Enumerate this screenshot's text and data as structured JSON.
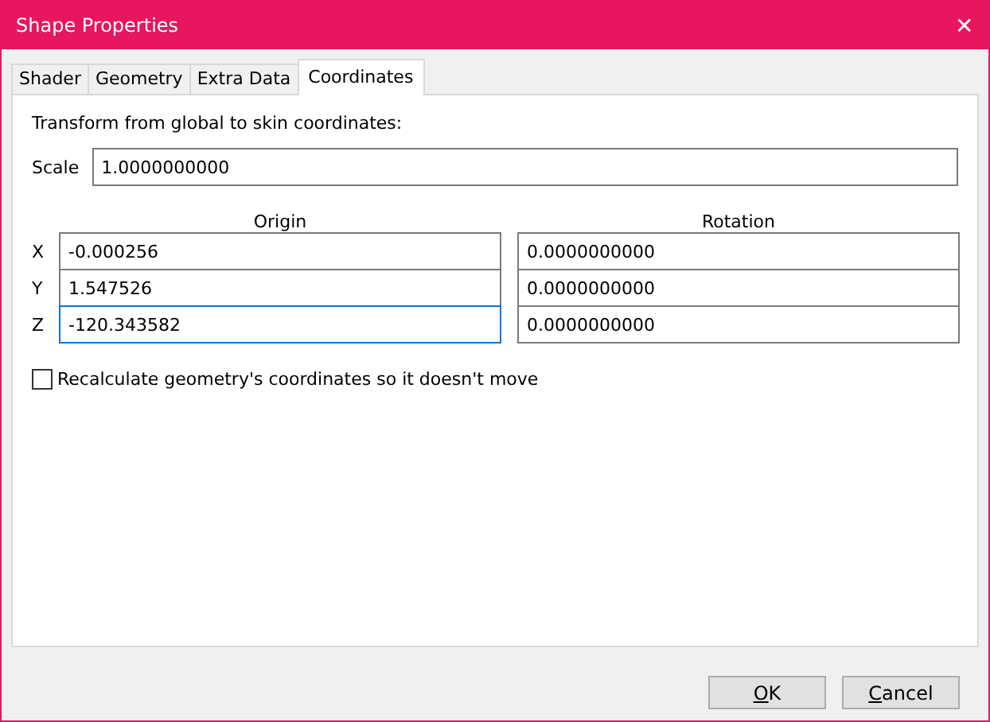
{
  "window": {
    "title": "Shape Properties",
    "close": "✕"
  },
  "tabs": [
    {
      "label": "Shader",
      "selected": false
    },
    {
      "label": "Geometry",
      "selected": false
    },
    {
      "label": "Extra Data",
      "selected": false
    },
    {
      "label": "Coordinates",
      "selected": true
    }
  ],
  "intro": "Transform from global to skin coordinates:",
  "scale": {
    "label": "Scale",
    "value": "1.0000000000",
    "focused": false
  },
  "columns": [
    "Origin",
    "Rotation"
  ],
  "rows": [
    {
      "axis": "X",
      "origin": {
        "value": "-0.000256",
        "focused": false
      },
      "rotation": {
        "value": "0.0000000000",
        "focused": false
      }
    },
    {
      "axis": "Y",
      "origin": {
        "value": "1.547526",
        "focused": false
      },
      "rotation": {
        "value": "0.0000000000",
        "focused": false
      }
    },
    {
      "axis": "Z",
      "origin": {
        "value": "-120.343582",
        "focused": true
      },
      "rotation": {
        "value": "0.0000000000",
        "focused": false
      }
    }
  ],
  "recalculate": {
    "label": "Recalculate geometry's coordinates so it doesn't move",
    "checked": false
  },
  "buttons": [
    {
      "label": "OK",
      "underline_first": true
    },
    {
      "label": "Cancel",
      "underline_first": true
    }
  ]
}
